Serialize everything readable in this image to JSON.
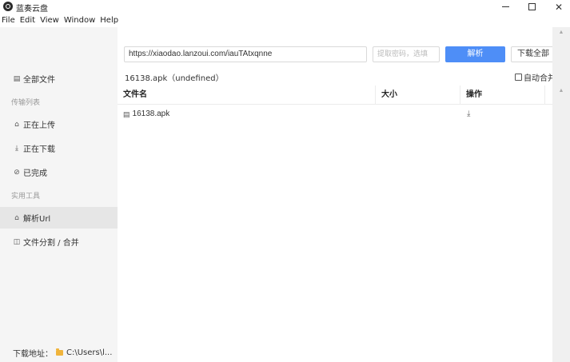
{
  "window": {
    "title": "蓝奏云盘",
    "minimize_icon": "minimize-icon",
    "maximize_icon": "maximize-icon",
    "close_symbol": "✕"
  },
  "menu": [
    "File",
    "Edit",
    "View",
    "Window",
    "Help"
  ],
  "sidebar": {
    "items": [
      {
        "label": "全部文件",
        "icon": "▤",
        "name": "all-files"
      },
      {
        "label": "正在上传",
        "icon": "⌂",
        "name": "uploading"
      },
      {
        "label": "正在下载",
        "icon": "⤓",
        "name": "downloading"
      },
      {
        "label": "已完成",
        "icon": "⊘",
        "name": "completed"
      },
      {
        "label": "解析Url",
        "icon": "⌂",
        "name": "parse-url"
      },
      {
        "label": "文件分割 / 合并",
        "icon": "◫",
        "name": "split-merge"
      }
    ],
    "sections": [
      "传输列表",
      "实用工具"
    ],
    "download_path_label": "下载地址：",
    "download_path_value": "C:\\Users\\l..."
  },
  "main": {
    "url_value": "https://xiaodao.lanzoui.com/iauTAtxqnne",
    "password_placeholder": "提取密码，选填",
    "parse_button": "解析",
    "download_all_button": "下载全部",
    "file_info": "16138.apk（undefined）",
    "auto_merge_label": "自动合并",
    "table": {
      "headers": [
        "文件名",
        "大小",
        "操作"
      ],
      "rows": [
        {
          "name": "16138.apk",
          "size": "",
          "action_icon": "download-icon"
        }
      ]
    }
  }
}
